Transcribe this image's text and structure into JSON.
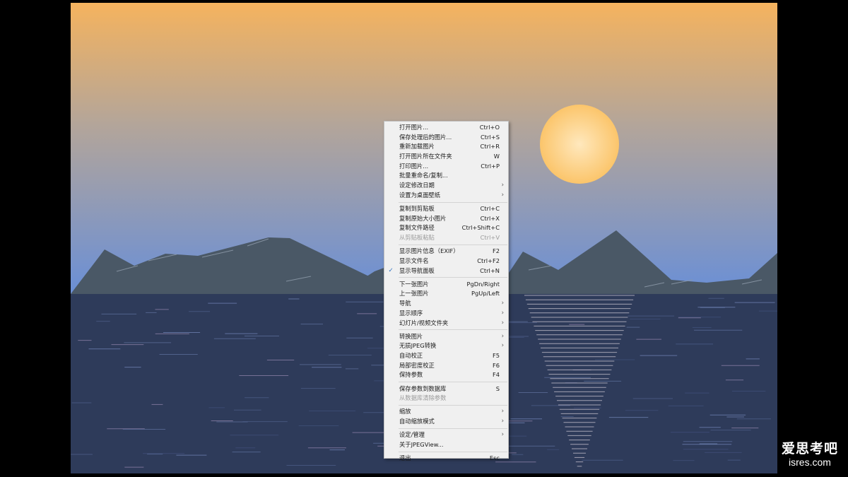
{
  "menu": {
    "items": [
      {
        "label": "打开图片...",
        "shortcut": "Ctrl+O"
      },
      {
        "label": "保存处理后的图片...",
        "shortcut": "Ctrl+S"
      },
      {
        "label": "重新加载图片",
        "shortcut": "Ctrl+R"
      },
      {
        "label": "打开图片所在文件夹",
        "shortcut": "W"
      },
      {
        "label": "打印图片...",
        "shortcut": "Ctrl+P"
      },
      {
        "label": "批量重命名/复制...",
        "shortcut": ""
      },
      {
        "label": "设定修改日期",
        "shortcut": "",
        "submenu": true
      },
      {
        "label": "设置为桌面壁纸",
        "shortcut": "",
        "submenu": true
      },
      {
        "separator": true
      },
      {
        "label": "复制到剪贴板",
        "shortcut": "Ctrl+C"
      },
      {
        "label": "复制原始大小图片",
        "shortcut": "Ctrl+X"
      },
      {
        "label": "复制文件路径",
        "shortcut": "Ctrl+Shift+C"
      },
      {
        "label": "从剪贴板粘贴",
        "shortcut": "Ctrl+V",
        "disabled": true
      },
      {
        "separator": true
      },
      {
        "label": "显示图片信息（EXIF）",
        "shortcut": "F2"
      },
      {
        "label": "显示文件名",
        "shortcut": "Ctrl+F2"
      },
      {
        "label": "显示导航面板",
        "shortcut": "Ctrl+N",
        "checked": true
      },
      {
        "separator": true
      },
      {
        "label": "下一张图片",
        "shortcut": "PgDn/Right"
      },
      {
        "label": "上一张图片",
        "shortcut": "PgUp/Left"
      },
      {
        "label": "导航",
        "shortcut": "",
        "submenu": true
      },
      {
        "label": "显示顺序",
        "shortcut": "",
        "submenu": true
      },
      {
        "label": "幻灯片/视频文件夹",
        "shortcut": "",
        "submenu": true
      },
      {
        "separator": true
      },
      {
        "label": "转换图片",
        "shortcut": "",
        "submenu": true
      },
      {
        "label": "无损JPEG转换",
        "shortcut": "",
        "submenu": true
      },
      {
        "label": "自动校正",
        "shortcut": "F5"
      },
      {
        "label": "局部密度校正",
        "shortcut": "F6"
      },
      {
        "label": "保持参数",
        "shortcut": "F4"
      },
      {
        "separator": true
      },
      {
        "label": "保存参数到数据库",
        "shortcut": "S"
      },
      {
        "label": "从数据库清除参数",
        "shortcut": "",
        "disabled": true
      },
      {
        "separator": true
      },
      {
        "label": "缩放",
        "shortcut": "",
        "submenu": true
      },
      {
        "label": "自动缩放模式",
        "shortcut": "",
        "submenu": true
      },
      {
        "separator": true
      },
      {
        "label": "设定/管理",
        "shortcut": "",
        "submenu": true
      },
      {
        "label": "关于JPEGView...",
        "shortcut": ""
      },
      {
        "separator": true
      },
      {
        "label": "退出",
        "shortcut": "Esc"
      }
    ],
    "check_glyph": "✓",
    "arrow_glyph": "›"
  },
  "watermark": {
    "line1": "爱思考吧",
    "line2": "isres.com"
  },
  "colors": {
    "sky_top": "#f5b35e",
    "sky_bottom": "#6a8fd6",
    "sun": "#fbc56b",
    "mountain": "#4a5866",
    "water": "#2e3b5a",
    "menu_bg": "#f0f0f0",
    "check": "#2a6ebf"
  },
  "icons": {
    "check": "checkmark-icon",
    "submenu": "chevron-right-icon"
  }
}
